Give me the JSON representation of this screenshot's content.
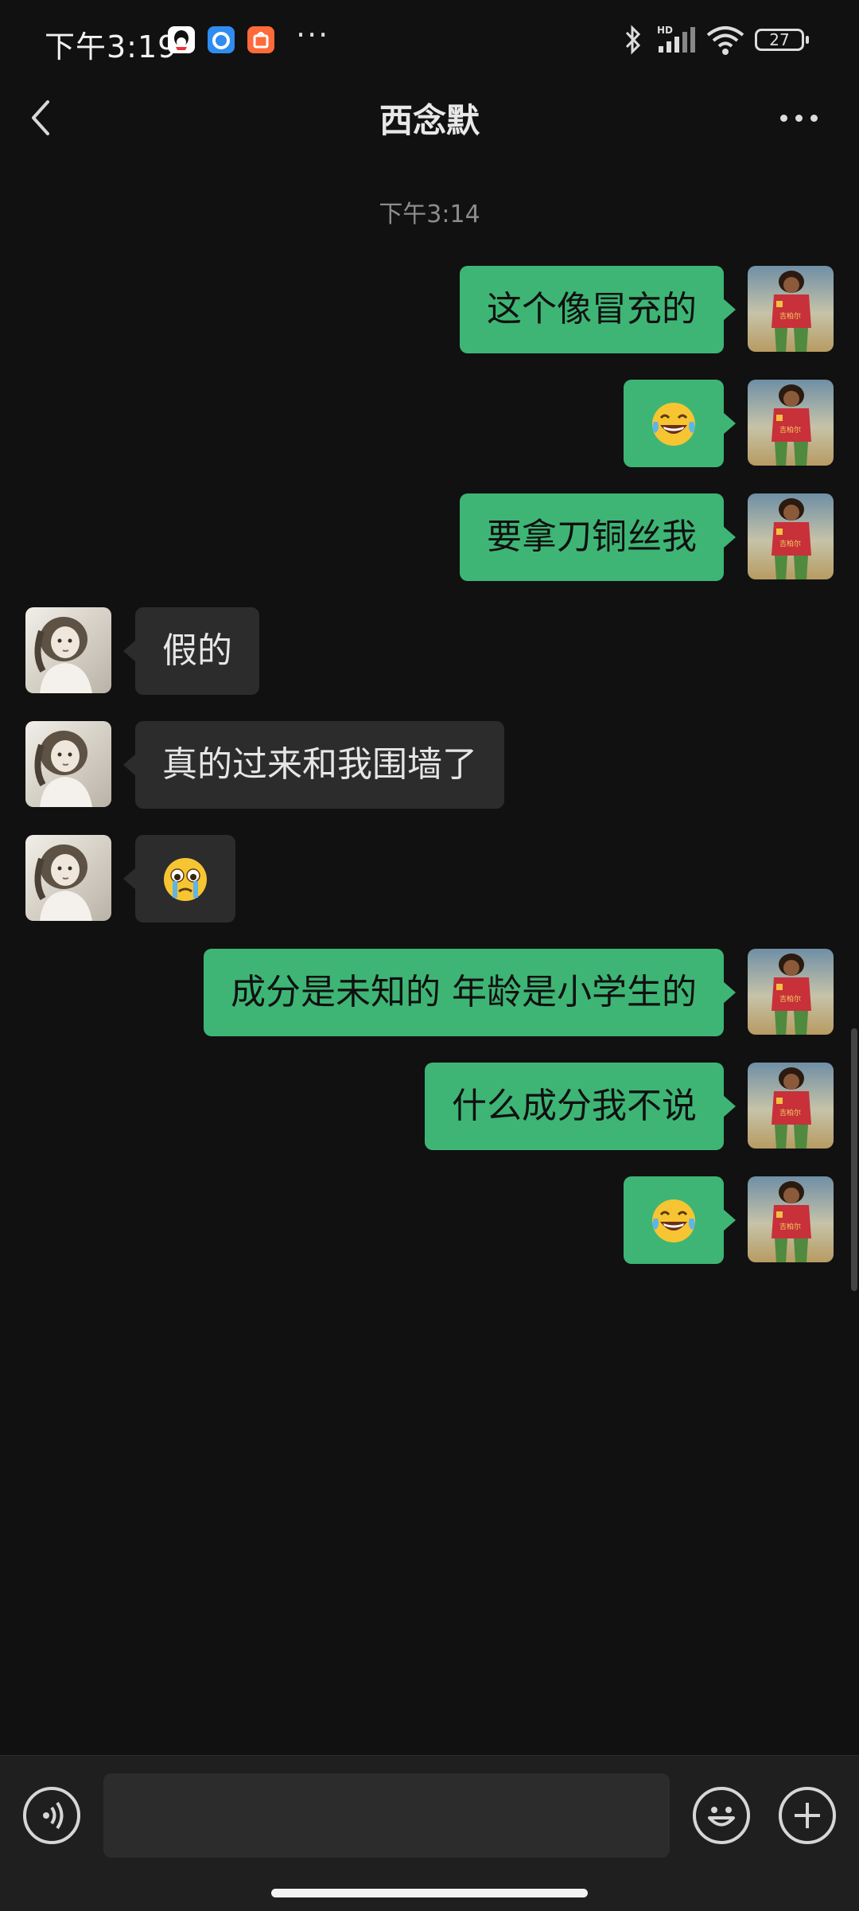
{
  "status_bar": {
    "time": "下午3:19",
    "more": "···",
    "network_badge": "HD",
    "battery": "27",
    "icons": [
      "qq-icon",
      "browser-icon",
      "shop-icon",
      "bluetooth-icon",
      "signal-icon",
      "wifi-icon",
      "battery-icon"
    ]
  },
  "header": {
    "title": "西念默",
    "icons": [
      "back-chevron-icon",
      "more-dots-icon"
    ]
  },
  "chat": {
    "time_divider": "下午3:14",
    "messages": [
      {
        "from": "self",
        "text": "这个像冒充的"
      },
      {
        "from": "self",
        "emoji": "tears-of-joy-icon"
      },
      {
        "from": "self",
        "text": "要拿刀铜丝我"
      },
      {
        "from": "other",
        "text": "假的"
      },
      {
        "from": "other",
        "text": "真的过来和我围墙了"
      },
      {
        "from": "other",
        "emoji": "crying-face-icon"
      },
      {
        "from": "self",
        "text": "成分是未知的 年龄是小学生的"
      },
      {
        "from": "self",
        "text": "什么成分我不说"
      },
      {
        "from": "self",
        "emoji": "tears-of-joy-icon"
      }
    ]
  },
  "input_bar": {
    "input_value": "",
    "icons": [
      "voice-icon",
      "emoji-icon",
      "plus-icon"
    ]
  },
  "colors": {
    "background": "#111111",
    "self_bubble": "#3eb575",
    "other_bubble": "#2c2c2c"
  }
}
